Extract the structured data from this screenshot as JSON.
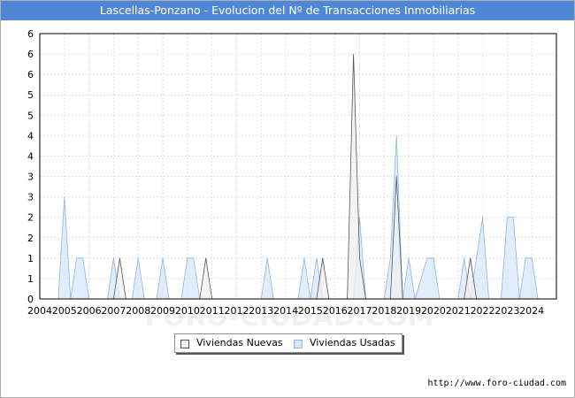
{
  "title": "Lascellas-Ponzano - Evolucion del Nº de Transacciones Inmobiliarias",
  "watermark": "FORO-CIUDAD.COM",
  "url": "http://www.foro-ciudad.com",
  "colors": {
    "title_bg": "#4f86d6",
    "nuevas_fill": "#efefef",
    "nuevas_stroke": "#555555",
    "usadas_fill": "#d7e7f8",
    "usadas_stroke": "#8fb4e0"
  },
  "chart_data": {
    "type": "area",
    "title": "Lascellas-Ponzano - Evolucion del Nº de Transacciones Inmobiliarias",
    "xlabel": "",
    "ylabel": "",
    "x_ticks": [
      "2004",
      "2005",
      "2006",
      "2007",
      "2008",
      "2009",
      "2010",
      "2011",
      "2012",
      "2013",
      "2014",
      "2015",
      "2016",
      "2017",
      "2018",
      "2019",
      "2020",
      "2021",
      "2022",
      "2023",
      "2024"
    ],
    "y_ticks": [
      "0",
      "1",
      "1",
      "2",
      "2",
      "3",
      "3",
      "4",
      "4",
      "5",
      "5",
      "6",
      "6",
      "6"
    ],
    "ylim": [
      0,
      6.5
    ],
    "xlim": [
      2004,
      2025
    ],
    "grid": true,
    "legend_position": "bottom-center",
    "series": [
      {
        "name": "Viviendas Nuevas",
        "points": [
          [
            2004,
            0
          ],
          [
            2007.0,
            0
          ],
          [
            2007.25,
            1
          ],
          [
            2007.5,
            0
          ],
          [
            2010.5,
            0
          ],
          [
            2010.75,
            1
          ],
          [
            2011.0,
            0
          ],
          [
            2015.25,
            0
          ],
          [
            2015.5,
            1
          ],
          [
            2015.75,
            0
          ],
          [
            2016.5,
            0
          ],
          [
            2016.75,
            6
          ],
          [
            2017.0,
            1
          ],
          [
            2017.25,
            0
          ],
          [
            2018.25,
            0
          ],
          [
            2018.5,
            3
          ],
          [
            2018.75,
            0
          ],
          [
            2021.25,
            0
          ],
          [
            2021.5,
            1
          ],
          [
            2021.75,
            0
          ],
          [
            2025,
            0
          ]
        ]
      },
      {
        "name": "Viviendas Usadas",
        "points": [
          [
            2004,
            0
          ],
          [
            2004.75,
            0
          ],
          [
            2005.0,
            2.5
          ],
          [
            2005.25,
            0
          ],
          [
            2005.5,
            1
          ],
          [
            2005.75,
            1
          ],
          [
            2006.0,
            0
          ],
          [
            2006.75,
            0
          ],
          [
            2007.0,
            1
          ],
          [
            2007.25,
            0
          ],
          [
            2007.75,
            0
          ],
          [
            2008.0,
            1
          ],
          [
            2008.25,
            0
          ],
          [
            2008.75,
            0
          ],
          [
            2009.0,
            1
          ],
          [
            2009.25,
            0
          ],
          [
            2009.75,
            0
          ],
          [
            2010.0,
            1
          ],
          [
            2010.25,
            1
          ],
          [
            2010.5,
            0
          ],
          [
            2013.0,
            0
          ],
          [
            2013.25,
            1
          ],
          [
            2013.5,
            0
          ],
          [
            2014.5,
            0
          ],
          [
            2014.75,
            1
          ],
          [
            2015.0,
            0
          ],
          [
            2015.25,
            1
          ],
          [
            2015.5,
            0
          ],
          [
            2016.75,
            0
          ],
          [
            2017.0,
            2
          ],
          [
            2017.25,
            0
          ],
          [
            2018.0,
            0
          ],
          [
            2018.25,
            1
          ],
          [
            2018.5,
            4
          ],
          [
            2018.75,
            0
          ],
          [
            2019.0,
            1
          ],
          [
            2019.25,
            0
          ],
          [
            2019.75,
            1
          ],
          [
            2020.0,
            1
          ],
          [
            2020.25,
            0
          ],
          [
            2021.0,
            0
          ],
          [
            2021.25,
            1
          ],
          [
            2021.5,
            0
          ],
          [
            2021.75,
            1
          ],
          [
            2022.0,
            2
          ],
          [
            2022.25,
            0
          ],
          [
            2022.75,
            0
          ],
          [
            2023.0,
            2
          ],
          [
            2023.25,
            2
          ],
          [
            2023.5,
            0
          ],
          [
            2023.75,
            1
          ],
          [
            2024.0,
            1
          ],
          [
            2024.25,
            0
          ],
          [
            2025,
            0
          ]
        ]
      }
    ]
  }
}
